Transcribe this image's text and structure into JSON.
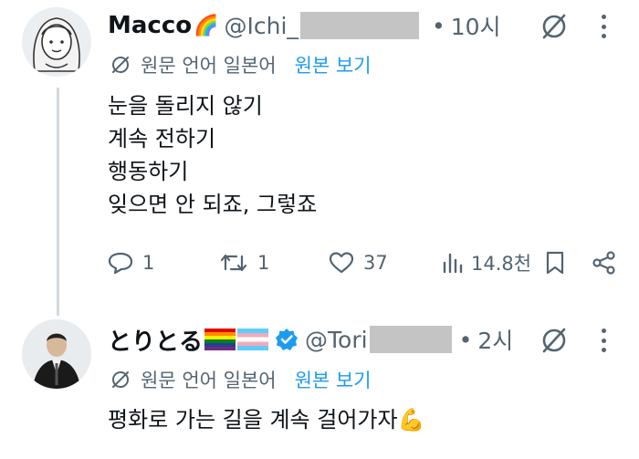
{
  "tweets": [
    {
      "name": "Macco",
      "name_emoji": "🌈",
      "handle": "@Ichi_",
      "dot": "•",
      "time": "10시",
      "translation_note": "원문 언어 일본어",
      "show_original": "원본 보기",
      "lines": [
        "눈을 돌리지 않기",
        "계속 전하기",
        "행동하기",
        "잊으면 안 되죠, 그렇죠"
      ],
      "stats": {
        "replies": "1",
        "reposts": "1",
        "likes": "37",
        "views": "14.8천"
      }
    },
    {
      "name": "とりとる",
      "handle": "@Tori",
      "dot": "•",
      "time": "2시",
      "translation_note": "원문 언어 일본어",
      "show_original": "원본 보기",
      "lines": [
        "평화로 가는 길을 계속 걸어가자💪"
      ]
    }
  ],
  "colors": {
    "text": "#0f1419",
    "secondary": "#536471",
    "link": "#1d9bf0",
    "thread_line": "#cfd9de",
    "redaction": "#c4c4c4"
  },
  "icons": [
    "grok-icon",
    "more-icon",
    "translate-icon",
    "reply-icon",
    "repost-icon",
    "like-icon",
    "views-icon",
    "bookmark-icon",
    "share-icon",
    "verified-icon",
    "rainbow-flag-icon",
    "trans-flag-icon"
  ]
}
